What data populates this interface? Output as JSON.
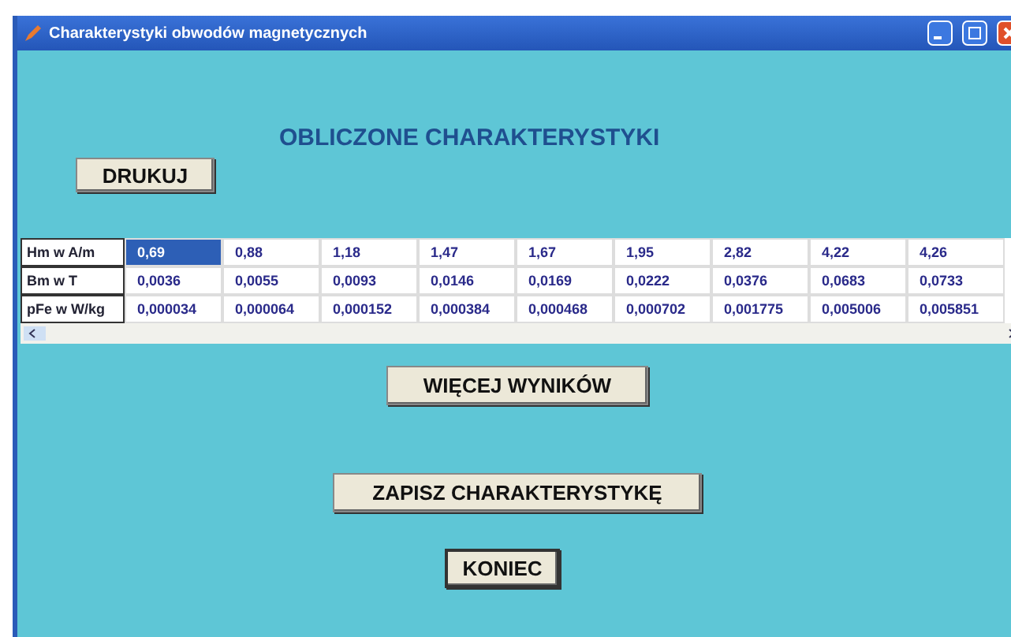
{
  "window": {
    "title": "Charakterystyki obwodów magnetycznych"
  },
  "heading": "OBLICZONE CHARAKTERYSTYKI",
  "print_button": "DRUKUJ",
  "table": {
    "rows": [
      {
        "label": "Hm w A/m",
        "cells": [
          {
            "text": "0,69",
            "selected": true
          },
          {
            "text": "0,88",
            "selected": false
          },
          {
            "text": "1,18",
            "selected": false
          },
          {
            "text": "1,47",
            "selected": false
          },
          {
            "text": "1,67",
            "selected": false
          },
          {
            "text": "1,95",
            "selected": false
          },
          {
            "text": "2,82",
            "selected": false
          },
          {
            "text": "4,22",
            "selected": false
          },
          {
            "text": "4,26",
            "selected": false
          }
        ]
      },
      {
        "label": "Bm w T",
        "cells": [
          {
            "text": "0,0036",
            "selected": false
          },
          {
            "text": "0,0055",
            "selected": false
          },
          {
            "text": "0,0093",
            "selected": false
          },
          {
            "text": "0,0146",
            "selected": false
          },
          {
            "text": "0,0169",
            "selected": false
          },
          {
            "text": "0,0222",
            "selected": false
          },
          {
            "text": "0,0376",
            "selected": false
          },
          {
            "text": "0,0683",
            "selected": false
          },
          {
            "text": "0,0733",
            "selected": false
          }
        ]
      },
      {
        "label": "pFe w W/kg",
        "cells": [
          {
            "text": "0,000034",
            "selected": false
          },
          {
            "text": "0,000064",
            "selected": false
          },
          {
            "text": "0,000152",
            "selected": false
          },
          {
            "text": "0,000384",
            "selected": false
          },
          {
            "text": "0,000468",
            "selected": false
          },
          {
            "text": "0,000702",
            "selected": false
          },
          {
            "text": "0,001775",
            "selected": false
          },
          {
            "text": "0,005006",
            "selected": false
          },
          {
            "text": "0,005851",
            "selected": false
          }
        ]
      }
    ]
  },
  "more_button": "WIĘCEJ WYNIKÓW",
  "save_button": "ZAPISZ CHARAKTERYSTYKĘ",
  "end_button": "KONIEC"
}
